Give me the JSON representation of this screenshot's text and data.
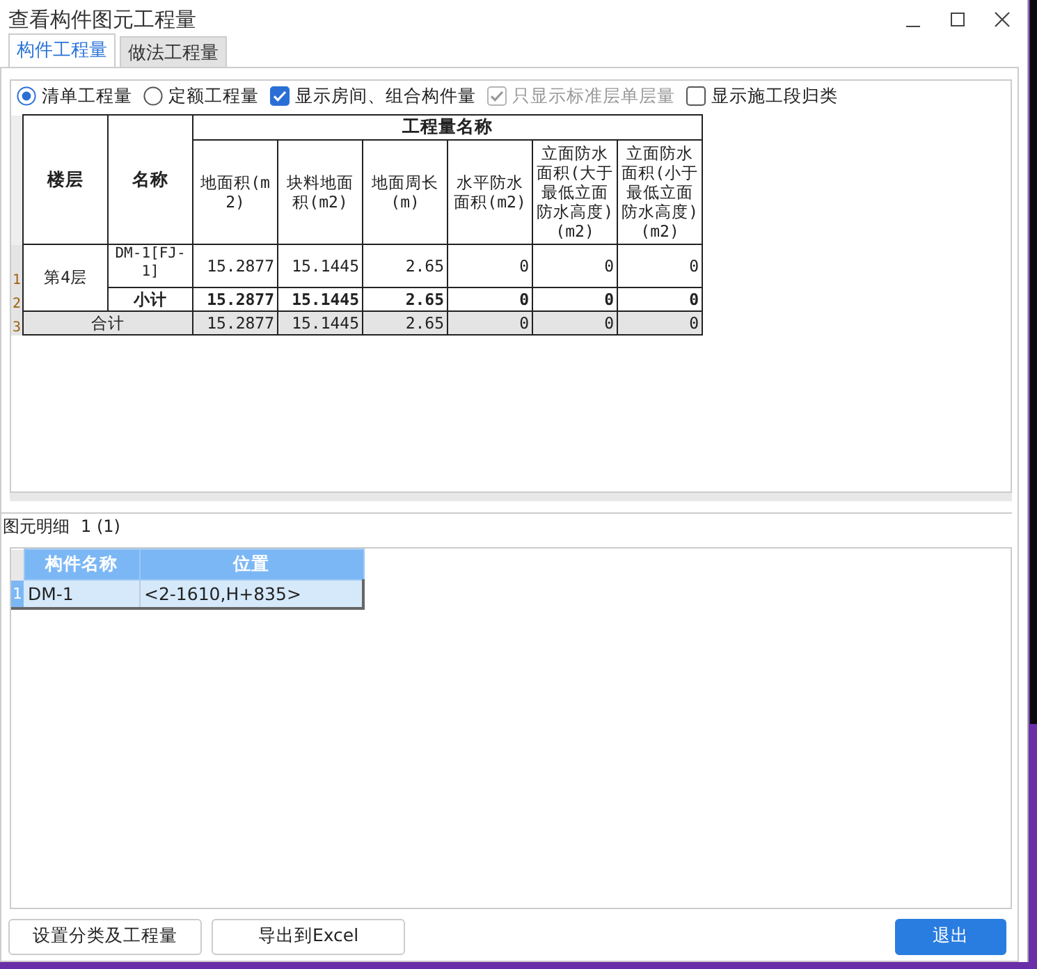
{
  "window": {
    "title": "查看构件图元工程量"
  },
  "tabs": [
    {
      "label": "构件工程量",
      "selected": true
    },
    {
      "label": "做法工程量",
      "selected": false
    }
  ],
  "options": [
    {
      "kind": "radio",
      "label": "清单工程量",
      "checked": true,
      "disabled": false
    },
    {
      "kind": "radio",
      "label": "定额工程量",
      "checked": false,
      "disabled": false
    },
    {
      "kind": "checkbox",
      "label": "显示房间、组合构件量",
      "checked": true,
      "disabled": false
    },
    {
      "kind": "checkbox",
      "label": "只显示标准层单层量",
      "checked": true,
      "disabled": true
    },
    {
      "kind": "checkbox",
      "label": "显示施工段归类",
      "checked": false,
      "disabled": false
    }
  ],
  "quantity_table": {
    "floor_header": "楼层",
    "name_header": "名称",
    "group_header": "工程量名称",
    "columns": [
      "地面积(m2)",
      "块料地面积(m2)",
      "地面周长(m)",
      "水平防水面积(m2)",
      "立面防水面积(大于最低立面防水高度)(m2)",
      "立面防水面积(小于最低立面防水高度)(m2)"
    ],
    "rows": [
      {
        "number": "1",
        "kind": "item",
        "floor": "第4层",
        "name": "DM-1[FJ-1]",
        "values": [
          "15.2877",
          "15.1445",
          "2.65",
          "0",
          "0",
          "0"
        ]
      },
      {
        "number": "2",
        "kind": "subtotal",
        "name": "小计",
        "values": [
          "15.2877",
          "15.1445",
          "2.65",
          "0",
          "0",
          "0"
        ]
      },
      {
        "number": "3",
        "kind": "total",
        "name": "合计",
        "values": [
          "15.2877",
          "15.1445",
          "2.65",
          "0",
          "0",
          "0"
        ]
      }
    ]
  },
  "detail": {
    "title": "图元明细",
    "count": "1 (1)",
    "columns": [
      "构件名称",
      "位置"
    ],
    "rows": [
      {
        "number": "1",
        "selected": true,
        "cells": [
          "DM-1",
          "<2-1610,H+835>"
        ]
      }
    ]
  },
  "buttons": [
    {
      "label": "设置分类及工程量",
      "kind": "default"
    },
    {
      "label": "导出到Excel",
      "kind": "default"
    },
    {
      "label": "退出",
      "kind": "primary"
    }
  ]
}
